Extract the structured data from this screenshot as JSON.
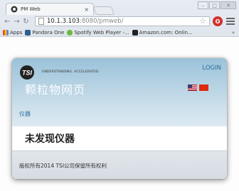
{
  "browser": {
    "tab_title": "PM Web",
    "tab_close": "×",
    "url_host": "10.1.3.103",
    "url_path": ":8080/pmweb/",
    "bookmarks": [
      {
        "label": "Apps",
        "icon": "apps-icon",
        "color": "#4285f4"
      },
      {
        "label": "Pandora One",
        "icon": "pandora-icon",
        "color": "#2b5f8c"
      },
      {
        "label": "Spotify Web Player -...",
        "icon": "spotify-icon",
        "color": "#6bb83b"
      },
      {
        "label": "Amazon.com: Onlin...",
        "icon": "amazon-icon",
        "color": "#222222"
      }
    ],
    "bookmarks_more": "»",
    "extension_label": "O"
  },
  "page": {
    "tagline": "UNDERSTANDING, ACCELERATED",
    "login": "LOGIN",
    "banner_title": "颗粒物网页",
    "breadcrumb": "仪器",
    "message": "未发现仪器",
    "copyright": "版权所有2014 TSI公司保留所有权利"
  },
  "colors": {
    "header_top": "#9ac2d9",
    "link": "#2d6e9a",
    "flag_cn": "#de2910"
  }
}
